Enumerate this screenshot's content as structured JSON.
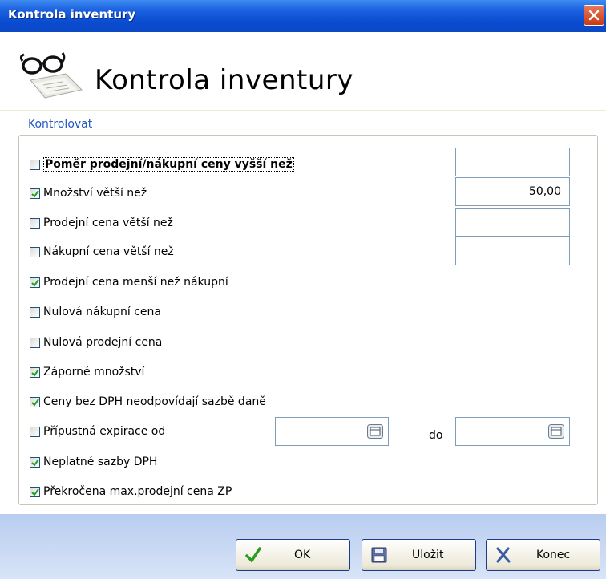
{
  "window": {
    "title": "Kontrola inventury"
  },
  "header": {
    "title": "Kontrola inventury"
  },
  "group": {
    "label": "Kontrolovat"
  },
  "options": [
    {
      "label": "Poměr prodejní/nákupní ceny vyšší než",
      "checked": false
    },
    {
      "label": "Množství větší než",
      "checked": true
    },
    {
      "label": "Prodejní cena větší než",
      "checked": false
    },
    {
      "label": "Nákupní cena větší než",
      "checked": false
    },
    {
      "label": "Prodejní cena menší než nákupní",
      "checked": true
    },
    {
      "label": "Nulová nákupní cena",
      "checked": false
    },
    {
      "label": "Nulová prodejní cena",
      "checked": false
    },
    {
      "label": "Záporné množství",
      "checked": true
    },
    {
      "label": "Ceny bez DPH neodpovídají sazbě daně",
      "checked": true
    },
    {
      "label": "Přípustná expirace od",
      "checked": false
    },
    {
      "label": "Neplatné sazby DPH",
      "checked": true
    },
    {
      "label": "Překročena max.prodejní cena ZP",
      "checked": true
    }
  ],
  "fields": {
    "ratio": "",
    "quantity": "50,00",
    "sell_price": "",
    "buy_price": "",
    "expiry_from": "",
    "expiry_to": ""
  },
  "expiry": {
    "to_label": "do"
  },
  "buttons": {
    "ok": "OK",
    "save": "Uložit",
    "close": "Konec"
  },
  "colors": {
    "titlebar": "#0a4bd1",
    "accent": "#2157c7",
    "footer": "#c4d6f3"
  }
}
